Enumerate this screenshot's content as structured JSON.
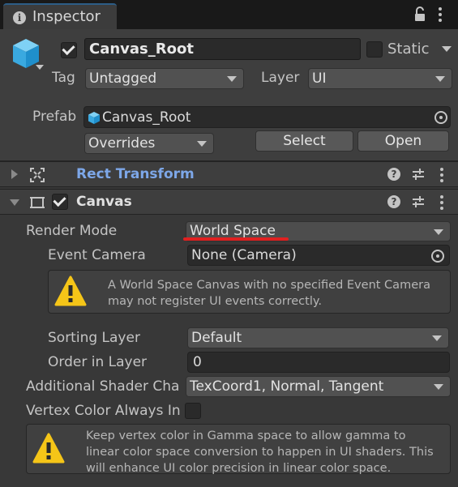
{
  "tab": {
    "title": "Inspector",
    "info_icon": "info-icon",
    "lock_icon": "lock-icon",
    "menu_icon": "kebab-menu-icon"
  },
  "gameobject": {
    "icon": "cube-icon",
    "active": true,
    "name": "Canvas_Root",
    "static_label": "Static",
    "static_checked": false,
    "tag_label": "Tag",
    "tag_value": "Untagged",
    "layer_label": "Layer",
    "layer_value": "UI",
    "prefab_label": "Prefab",
    "prefab_value": "Canvas_Root",
    "overrides_value": "Overrides",
    "select_label": "Select",
    "open_label": "Open"
  },
  "rect_transform": {
    "title": "Rect Transform",
    "icon": "rect-transform-icon",
    "expanded": false
  },
  "canvas": {
    "title": "Canvas",
    "icon": "canvas-icon",
    "enabled": true,
    "expanded": true,
    "render_mode_label": "Render Mode",
    "render_mode_value": "World Space",
    "event_camera_label": "Event Camera",
    "event_camera_value": "None (Camera)",
    "warning1": "A World Space Canvas with no specified Event Camera may not register UI events correctly.",
    "sorting_layer_label": "Sorting Layer",
    "sorting_layer_value": "Default",
    "order_label": "Order in Layer",
    "order_value": "0",
    "shader_label": "Additional Shader Cha",
    "shader_value": "TexCoord1, Normal, Tangent",
    "vertex_label": "Vertex Color Always In",
    "vertex_checked": false,
    "warning2": "Keep vertex color in Gamma space to allow gamma to linear color space conversion to happen in UI shaders. This will enhance UI color precision in linear color space."
  },
  "colors": {
    "accent_underline": "#e02020",
    "rect_transform_title": "#7da7e8",
    "warning": "#f5c518"
  }
}
